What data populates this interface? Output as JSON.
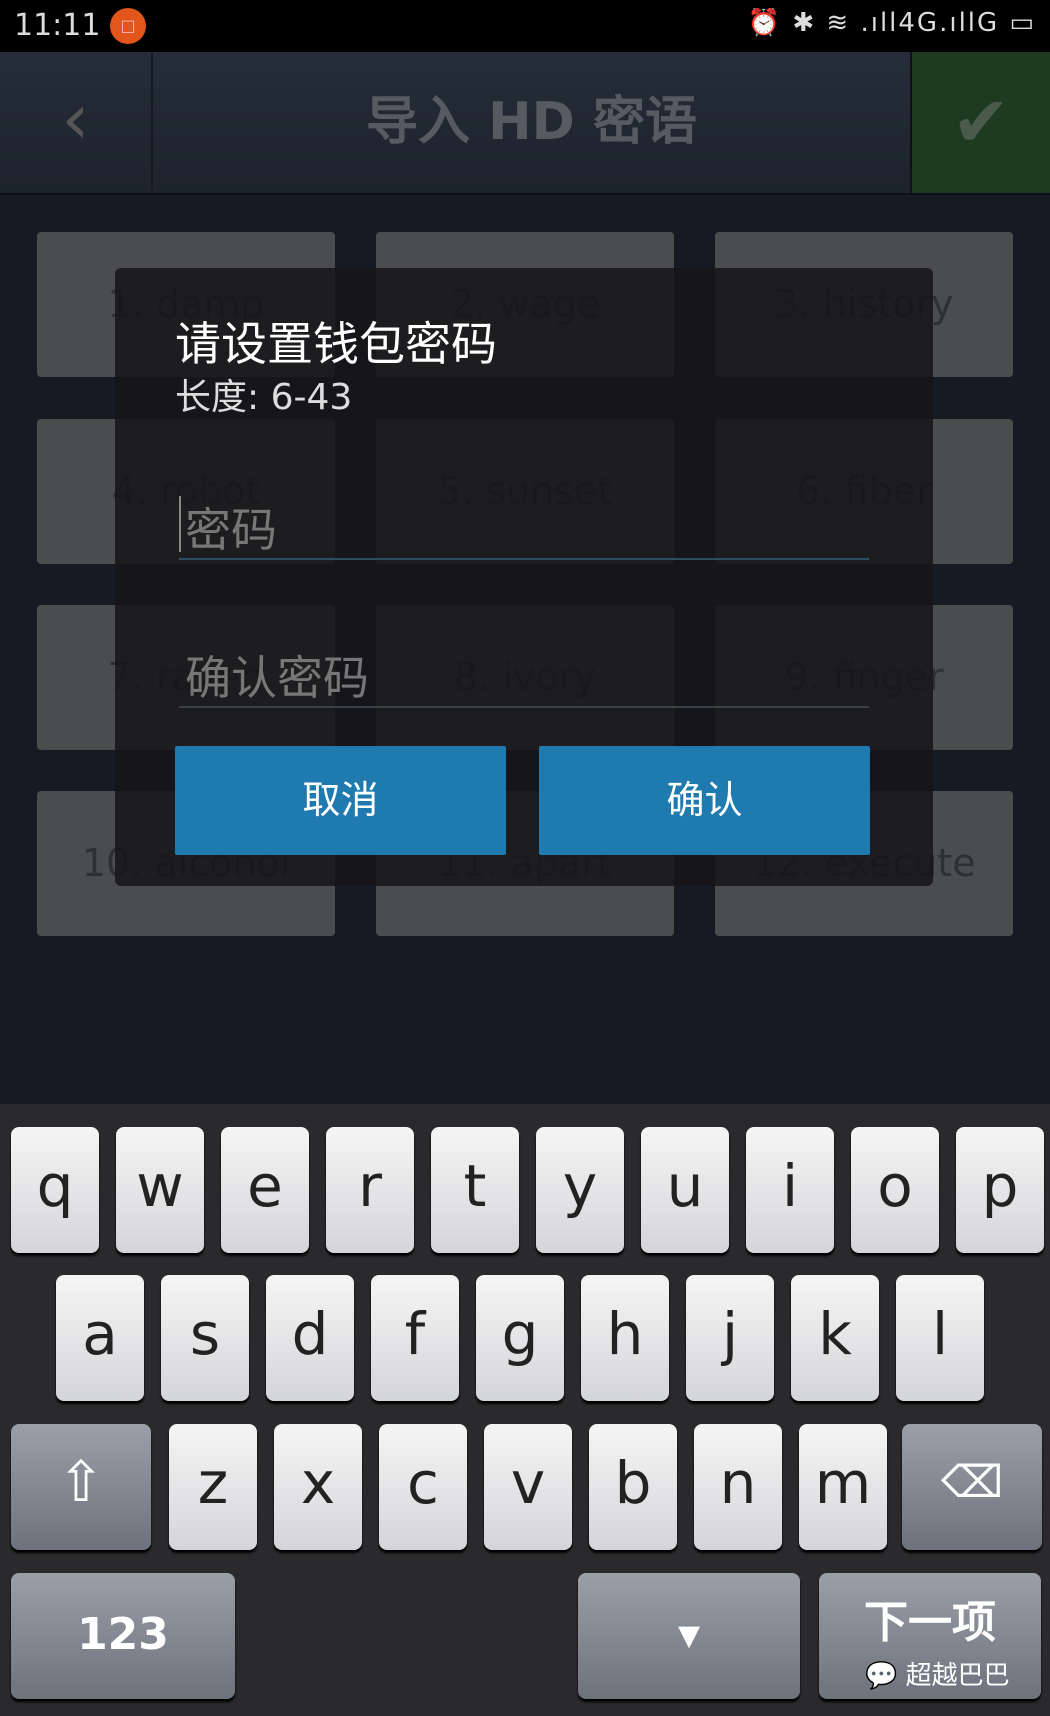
{
  "status": {
    "time": "11:11",
    "notif_icon": "app-notification-icon",
    "icons": "⏰ ✱ ≋ .ıll4G.ıllG ▭"
  },
  "header": {
    "title": "导入 HD 密语",
    "back_icon": "chevron-left-icon",
    "confirm_icon": "check-icon"
  },
  "words": [
    "1. damp",
    "2. wage",
    "3. history",
    "4. robot",
    "5. sunset",
    "6. fiber",
    "7. raven",
    "8. ivory",
    "9. finger",
    "10. alcohol",
    "11. apart",
    "12. execute"
  ],
  "dialog": {
    "title": "请设置钱包密码",
    "subtitle": "长度: 6-43",
    "password_placeholder": "密码",
    "confirm_placeholder": "确认密码",
    "cancel": "取消",
    "confirm": "确认"
  },
  "keyboard": {
    "row1": [
      "q",
      "w",
      "e",
      "r",
      "t",
      "y",
      "u",
      "i",
      "o",
      "p"
    ],
    "row2": [
      "a",
      "s",
      "d",
      "f",
      "g",
      "h",
      "j",
      "k",
      "l"
    ],
    "row3": [
      "z",
      "x",
      "c",
      "v",
      "b",
      "n",
      "m"
    ],
    "numbers": "123",
    "next": "下一项",
    "shift_icon": "shift-icon",
    "backspace_icon": "backspace-icon",
    "hide_icon": "keyboard-hide-icon"
  },
  "watermark": "超越巴巴",
  "colors": {
    "accent": "#1f7ab0",
    "confirm_bg": "#1e3b22"
  }
}
